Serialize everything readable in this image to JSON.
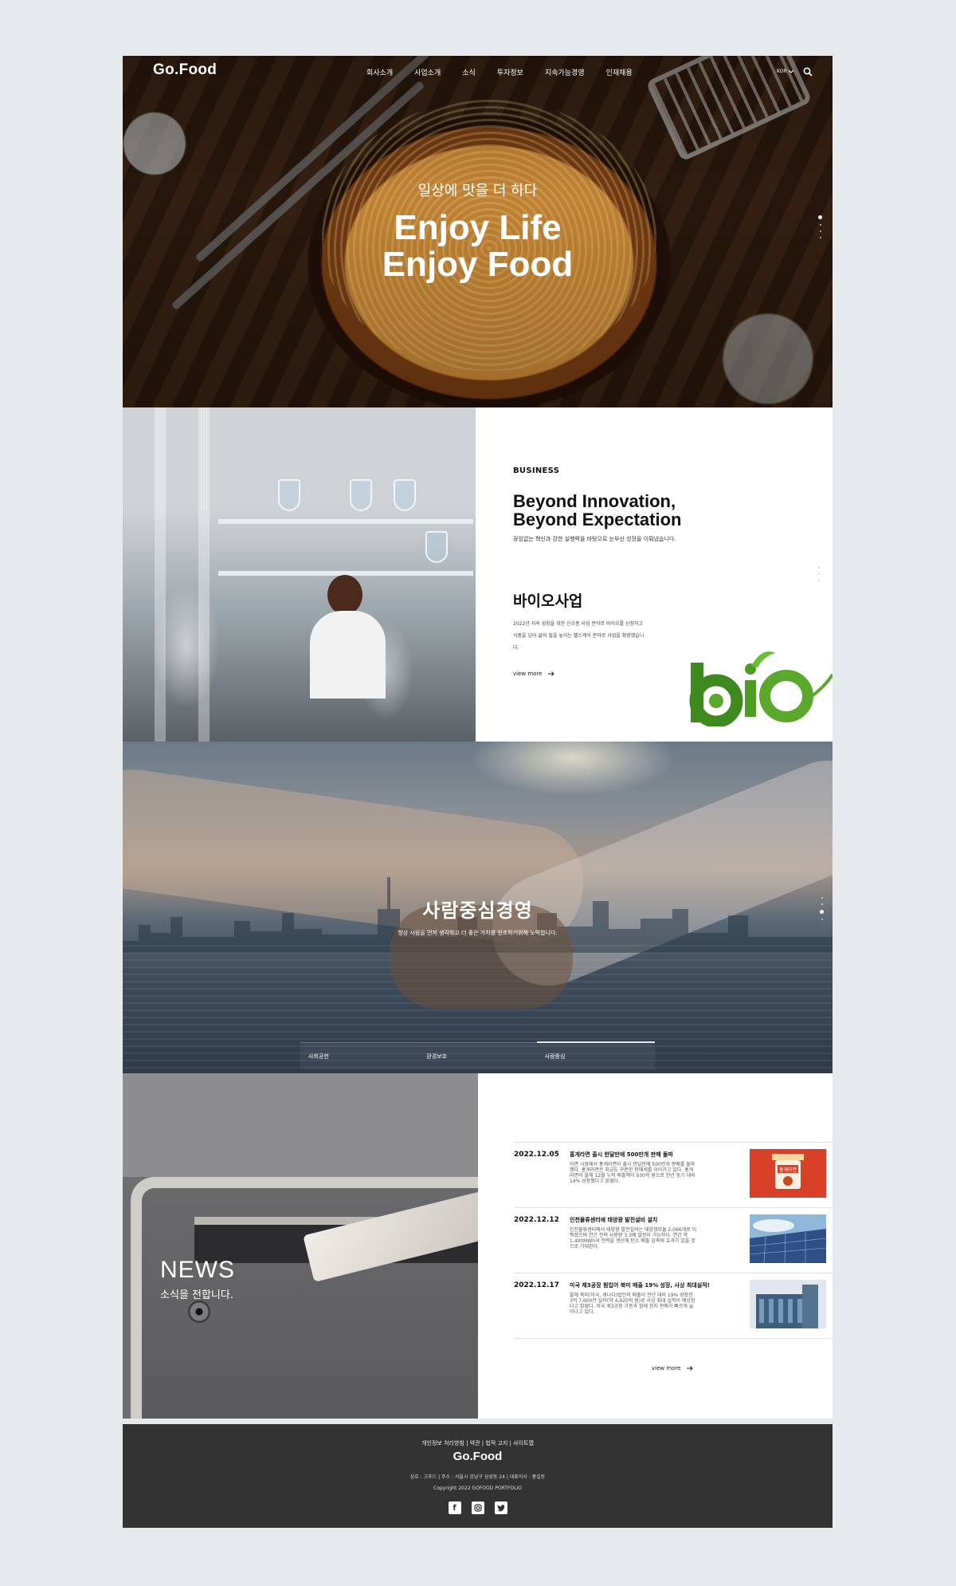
{
  "header": {
    "logo": "Go.Food",
    "menu": [
      "회사소개",
      "사업소개",
      "소식",
      "투자정보",
      "지속가능경영",
      "인재채용"
    ],
    "lang": "KOR",
    "icons": {
      "search": "search-icon",
      "lang": "chevron-down-icon"
    }
  },
  "hero": {
    "subtitle": "일상에 맛을 더 하다",
    "title_line1": "Enjoy Life",
    "title_line2": "Enjoy Food"
  },
  "business": {
    "label": "BUSINESS",
    "title_line1": "Beyond Innovation,",
    "title_line2": "Beyond Expectation",
    "description": "끊임없는 혁신과 강한 실행력을 바탕으로 눈부신 성장을 이뤄냈습니다.",
    "heading": "바이오사업",
    "body": "2022년 지속 성장을 위한 신수종 사업 분야로 바이오를 선정하고 식품을 넘어 삶의 질을 높이는 헬스케어 분야로 사업을 확장했습니다.",
    "view_more": "view more",
    "logo_text": "bio"
  },
  "people": {
    "title": "사람중심경영",
    "description": "항상 사람을 먼저 생각하고 더 좋은 가치를 창조하기위해 노력합니다.",
    "tabs": [
      "사회공헌",
      "환경보호",
      "사람중심"
    ]
  },
  "news": {
    "label": "NEWS",
    "sublabel": "소식을 전합니다.",
    "items": [
      {
        "date": "2022.12.05",
        "title": "홍게라면 출시 한달만에 500만개 판매 돌파",
        "body": "라면 시장에서 홍게라면이 출시 한달만에 500만개 판매를 돌파했다. 홍게라면은 지금도 꾸준한 판매세를 이어가고 있다. 홍게라면의 올해 12월 누적 매출액이 930억 원으로 전년 동기 대비 14% 성장했다고 밝혔다.",
        "thumb_text": "홍게라면"
      },
      {
        "date": "2022.12.12",
        "title": "인천물류센터에 태양광 발전설비 설치",
        "body": "인천물류센터에서 태양광 발전설비는 태양광모듈 2,066개로 이뤄졌으며 연간 전력 사용량 3.3배 발전이 가능하다. 연간 약 1,400MWh의 전력을 생산해 탄소 배출 감축에 효과가 있을 것으로 기대된다.",
        "thumb_text": ""
      },
      {
        "date": "2022.12.17",
        "title": "미국 제3공장 힘입어 북미 매출 19% 성장, 사상 최대실적!",
        "body": "올해 북미(미국, 캐나다)법인의 매출이 전년 대비 19% 성장한 3억 7,600만 달러(약 4,920억 원)로 사상 최대 실적이 예상된다고 밝혔다. 미국 제3공장 가동과 함께 현지 판매가 빠르게 늘어나고 있다.",
        "thumb_text": ""
      }
    ],
    "view_more": "view more"
  },
  "footer": {
    "links": "개인정보 처리방침 | 약관 | 법적 고지 | 사이트맵",
    "logo": "Go.Food",
    "info": "상호 : 고푸드 | 주소 : 서울시 강남구 삼성동 24 | 대표이사 : 홍길동",
    "copyright": "Copyright 2022 GOFOOD PORTFOLIO",
    "social": [
      "facebook-icon",
      "instagram-icon",
      "twitter-icon"
    ]
  },
  "colors": {
    "page_bg": "#e6eaed",
    "footer_bg": "#333333",
    "bio_green": "#3f8a1f",
    "news_red": "#d9402a"
  }
}
